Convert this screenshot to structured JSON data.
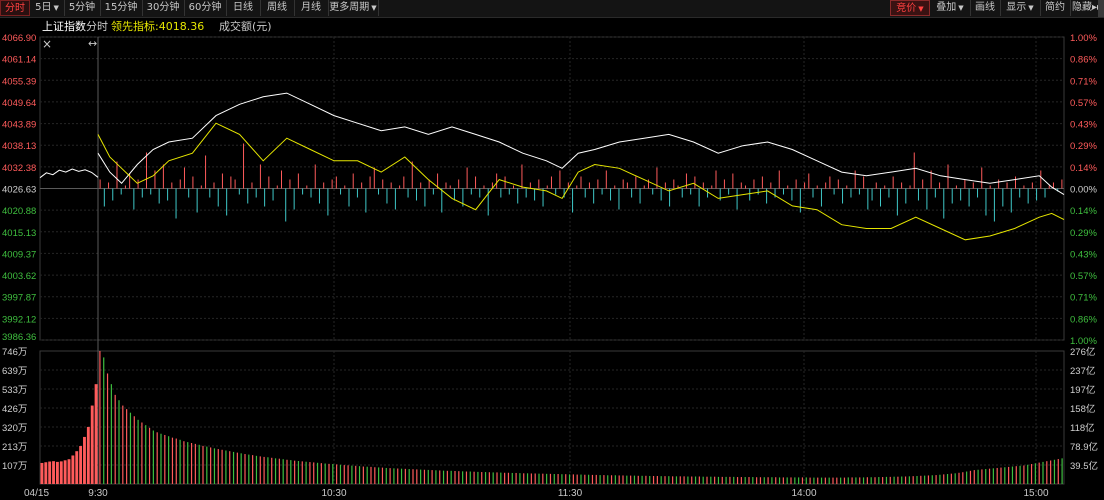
{
  "toolbar": {
    "tabs_left": [
      {
        "label": "分时",
        "active": true
      },
      {
        "label": "5日",
        "dropdown": true
      },
      {
        "label": "5分钟"
      },
      {
        "label": "15分钟"
      },
      {
        "label": "30分钟"
      },
      {
        "label": "60分钟"
      },
      {
        "label": "日线"
      },
      {
        "label": "周线"
      },
      {
        "label": "月线"
      },
      {
        "label": "更多周期",
        "dropdown": true
      }
    ],
    "tabs_right": [
      {
        "label": "竞价",
        "dropdown": true,
        "selected": true
      },
      {
        "label": "叠加",
        "dropdown": true
      },
      {
        "label": "画线"
      },
      {
        "label": "显示",
        "dropdown": true
      },
      {
        "label": "简约"
      },
      {
        "label": "隐藏▸▸"
      }
    ]
  },
  "header": {
    "index_name": "上证指数",
    "mode": "分时",
    "leading_label": "领先指标:",
    "leading_value": "4018.36",
    "volume_label": "成交额(元)"
  },
  "colors": {
    "up": "#ff5b5b",
    "down": "#3fc8c8",
    "flat": "#d0d0d0",
    "price_line": "#ffffff",
    "leading_line": "#e6e600",
    "grid": "#262626",
    "vol_up": "#ff5b5b",
    "vol_down": "#3fbf3f"
  },
  "chart_data": {
    "type": "line",
    "date": "04/15",
    "x_ticks": [
      "9:30",
      "10:30",
      "11:30",
      "14:00",
      "15:00"
    ],
    "pre_close": 4026.63,
    "price_axis": [
      "4066.90",
      "4061.14",
      "4055.39",
      "4049.64",
      "4043.89",
      "4038.13",
      "4032.38",
      "4026.63",
      "4020.88",
      "4015.13",
      "4009.37",
      "4003.62",
      "3997.87",
      "3992.12",
      "3986.36"
    ],
    "pct_axis": [
      "1.00%",
      "0.86%",
      "0.71%",
      "0.57%",
      "0.43%",
      "0.29%",
      "0.14%",
      "0.00%",
      "0.14%",
      "0.29%",
      "0.43%",
      "0.57%",
      "0.71%",
      "0.86%",
      "1.00%"
    ],
    "ylim": [
      3986.36,
      4066.9
    ],
    "volume_axis_left": [
      "746万",
      "639万",
      "533万",
      "426万",
      "320万",
      "213万",
      "107万"
    ],
    "volume_axis_right": [
      "276亿",
      "237亿",
      "197亿",
      "158亿",
      "118亿",
      "78.9亿",
      "39.5亿"
    ],
    "volume_max": 746,
    "auction_price": [
      [
        0,
        4029.5
      ],
      [
        1,
        4030.8
      ],
      [
        2,
        4030.3
      ],
      [
        3,
        4031.5
      ],
      [
        4,
        4031.0
      ],
      [
        5,
        4031.8
      ],
      [
        6,
        4031.2
      ],
      [
        7,
        4031.6
      ],
      [
        8,
        4030.9
      ],
      [
        9,
        4029.6
      ]
    ],
    "auction_volume": [
      118,
      122,
      126,
      128,
      124,
      127,
      133,
      139,
      160,
      184,
      213,
      264,
      320,
      440,
      560
    ],
    "series": [
      {
        "name": "上证指数",
        "points": [
          [
            0,
            4036
          ],
          [
            3,
            4031
          ],
          [
            6,
            4028
          ],
          [
            10,
            4033
          ],
          [
            14,
            4037
          ],
          [
            18,
            4039
          ],
          [
            24,
            4040
          ],
          [
            30,
            4046
          ],
          [
            36,
            4049
          ],
          [
            42,
            4051
          ],
          [
            48,
            4052
          ],
          [
            54,
            4049
          ],
          [
            60,
            4046
          ],
          [
            66,
            4044
          ],
          [
            72,
            4042
          ],
          [
            78,
            4043
          ],
          [
            84,
            4041
          ],
          [
            90,
            4043
          ],
          [
            96,
            4041
          ],
          [
            102,
            4039
          ],
          [
            108,
            4036
          ],
          [
            114,
            4034
          ],
          [
            118,
            4032
          ],
          [
            122,
            4036
          ],
          [
            126,
            4037
          ],
          [
            132,
            4039
          ],
          [
            138,
            4040
          ],
          [
            144,
            4041
          ],
          [
            150,
            4039
          ],
          [
            156,
            4036
          ],
          [
            162,
            4038
          ],
          [
            168,
            4039
          ],
          [
            174,
            4037
          ],
          [
            180,
            4034
          ],
          [
            186,
            4031
          ],
          [
            192,
            4030
          ],
          [
            198,
            4031
          ],
          [
            204,
            4032
          ],
          [
            210,
            4030
          ],
          [
            216,
            4029
          ],
          [
            222,
            4028
          ],
          [
            228,
            4029
          ],
          [
            234,
            4030
          ],
          [
            237,
            4027
          ],
          [
            240,
            4025
          ]
        ]
      },
      {
        "name": "领先指标",
        "points": [
          [
            0,
            4041
          ],
          [
            3,
            4035
          ],
          [
            6,
            4032
          ],
          [
            10,
            4028
          ],
          [
            14,
            4030
          ],
          [
            18,
            4034
          ],
          [
            24,
            4036
          ],
          [
            30,
            4044
          ],
          [
            36,
            4041
          ],
          [
            42,
            4034
          ],
          [
            48,
            4040
          ],
          [
            54,
            4037
          ],
          [
            60,
            4034
          ],
          [
            66,
            4034
          ],
          [
            72,
            4031
          ],
          [
            78,
            4035
          ],
          [
            84,
            4029
          ],
          [
            90,
            4024
          ],
          [
            96,
            4021
          ],
          [
            102,
            4029
          ],
          [
            108,
            4027
          ],
          [
            114,
            4026
          ],
          [
            118,
            4024
          ],
          [
            122,
            4031
          ],
          [
            126,
            4033
          ],
          [
            132,
            4032
          ],
          [
            138,
            4029
          ],
          [
            144,
            4026
          ],
          [
            150,
            4028
          ],
          [
            156,
            4024
          ],
          [
            162,
            4025
          ],
          [
            168,
            4026
          ],
          [
            174,
            4022
          ],
          [
            180,
            4021
          ],
          [
            186,
            4017
          ],
          [
            192,
            4016
          ],
          [
            198,
            4016
          ],
          [
            204,
            4019
          ],
          [
            210,
            4016
          ],
          [
            216,
            4013
          ],
          [
            222,
            4014
          ],
          [
            228,
            4016
          ],
          [
            234,
            4019
          ],
          [
            237,
            4020
          ],
          [
            240,
            4018.36
          ]
        ]
      }
    ],
    "breadth": [
      3,
      -6,
      2,
      -4,
      9,
      -2,
      1,
      5,
      -7,
      3,
      -3,
      12,
      -2,
      6,
      -5,
      8,
      -4,
      2,
      -10,
      3,
      7,
      -3,
      4,
      -8,
      1,
      11,
      -3,
      2,
      -6,
      5,
      -9,
      4,
      3,
      -2,
      15,
      -5,
      2,
      -3,
      8,
      -6,
      4,
      -4,
      1,
      6,
      -11,
      3,
      -7,
      5,
      -2,
      1,
      -3,
      8,
      -5,
      2,
      -9,
      3,
      4,
      -2,
      1,
      -6,
      5,
      -3,
      2,
      -8,
      4,
      7,
      -2,
      3,
      -5,
      2,
      -7,
      1,
      4,
      -3,
      9,
      -4,
      2,
      -6,
      3,
      -2,
      5,
      -8,
      2,
      1,
      -4,
      3,
      -6,
      7,
      -2,
      4,
      -3,
      1,
      -9,
      2,
      5,
      -3,
      4,
      -2,
      1,
      -5,
      8,
      -3,
      2,
      -4,
      3,
      -6,
      1,
      4,
      -2,
      6,
      -3,
      2,
      -8,
      1,
      4,
      -3,
      2,
      -5,
      3,
      -2,
      6,
      -4,
      1,
      -7,
      3,
      2,
      -3,
      4,
      -5,
      1,
      3,
      -2,
      7,
      -4,
      2,
      -6,
      3,
      1,
      -3,
      5,
      -2,
      4,
      -6,
      2,
      -3,
      1,
      6,
      -4,
      3,
      -2,
      5,
      -7,
      2,
      1,
      -4,
      3,
      -2,
      4,
      -5,
      2,
      -3,
      6,
      -2,
      1,
      -4,
      3,
      -8,
      2,
      5,
      -3,
      1,
      -6,
      2,
      4,
      -2,
      3,
      -5,
      1,
      -3,
      6,
      -2,
      4,
      -7,
      -4,
      2,
      -6,
      1,
      -3,
      4,
      -9,
      2,
      -5,
      1,
      12,
      -4,
      3,
      -7,
      6,
      -3,
      2,
      -10,
      8,
      -5,
      1,
      -4,
      3,
      -6,
      2,
      -3,
      7,
      -9,
      1,
      -11,
      3,
      -6,
      2,
      -8,
      4,
      -3,
      1,
      -5,
      2,
      -4,
      6,
      -3,
      1,
      2,
      -1,
      3
    ],
    "volume": [
      746,
      710,
      620,
      560,
      500,
      470,
      440,
      420,
      400,
      380,
      360,
      345,
      330,
      315,
      300,
      290,
      282,
      275,
      268,
      260,
      255,
      248,
      240,
      235,
      230,
      225,
      220,
      214,
      210,
      205,
      200,
      196,
      192,
      188,
      184,
      180,
      176,
      172,
      168,
      165,
      162,
      158,
      155,
      152,
      150,
      147,
      144,
      142,
      139,
      136,
      134,
      131,
      129,
      127,
      125,
      123,
      121,
      119,
      117,
      115,
      113,
      112,
      110,
      108,
      106,
      105,
      103,
      102,
      100,
      98,
      97,
      96,
      94,
      93,
      92,
      90,
      89,
      88,
      87,
      86,
      85,
      84,
      83,
      82,
      81,
      80,
      79,
      78,
      77,
      76,
      75,
      74,
      74,
      73,
      72,
      71,
      70,
      70,
      69,
      68,
      67,
      67,
      66,
      65,
      65,
      64,
      63,
      63,
      62,
      62,
      61,
      60,
      60,
      59,
      59,
      58,
      58,
      57,
      57,
      56,
      56,
      55,
      55,
      54,
      54,
      53,
      53,
      52,
      52,
      51,
      51,
      50,
      50,
      49,
      49,
      49,
      48,
      48,
      47,
      47,
      47,
      46,
      46,
      46,
      45,
      45,
      45,
      44,
      44,
      44,
      43,
      43,
      43,
      43,
      42,
      42,
      42,
      42,
      41,
      41,
      41,
      41,
      40,
      40,
      40,
      40,
      40,
      39,
      39,
      39,
      39,
      39,
      38,
      38,
      38,
      38,
      38,
      38,
      37,
      37,
      37,
      37,
      37,
      37,
      37,
      37,
      36,
      36,
      36,
      36,
      36,
      36,
      36,
      36,
      36,
      36,
      37,
      37,
      37,
      37,
      37,
      38,
      38,
      38,
      39,
      39,
      40,
      40,
      41,
      41,
      42,
      42,
      43,
      44,
      45,
      46,
      47,
      48,
      49,
      50,
      52,
      54,
      56,
      58,
      60,
      63,
      66,
      70,
      74,
      78,
      80,
      82,
      84,
      86,
      88,
      90,
      92,
      94,
      96,
      98,
      100,
      102,
      104,
      108,
      112,
      116,
      120,
      124,
      128,
      132,
      136,
      140,
      144
    ],
    "volume_direction": "mixed"
  }
}
